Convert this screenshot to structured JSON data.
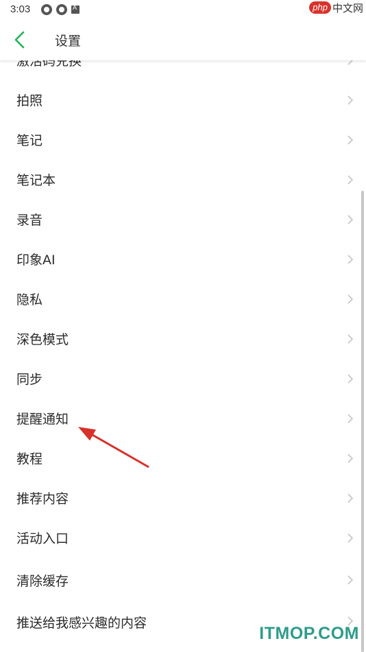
{
  "status_bar": {
    "time": "3:03"
  },
  "header": {
    "title": "设置"
  },
  "settings": {
    "items": [
      {
        "label": "激活码兑换"
      },
      {
        "label": "拍照"
      },
      {
        "label": "笔记"
      },
      {
        "label": "笔记本"
      },
      {
        "label": "录音"
      },
      {
        "label": "印象AI"
      },
      {
        "label": "隐私"
      },
      {
        "label": "深色模式"
      },
      {
        "label": "同步"
      },
      {
        "label": "提醒通知"
      },
      {
        "label": "教程"
      },
      {
        "label": "推荐内容"
      },
      {
        "label": "活动入口"
      },
      {
        "label": "清除缓存"
      },
      {
        "label": "推送给我感兴趣的内容"
      }
    ]
  },
  "watermarks": {
    "php_badge": "php",
    "php_text": "中文网",
    "itmop": "ITMOP.COM"
  },
  "colors": {
    "accent": "#1fb355",
    "annotation": "#d8302a"
  }
}
